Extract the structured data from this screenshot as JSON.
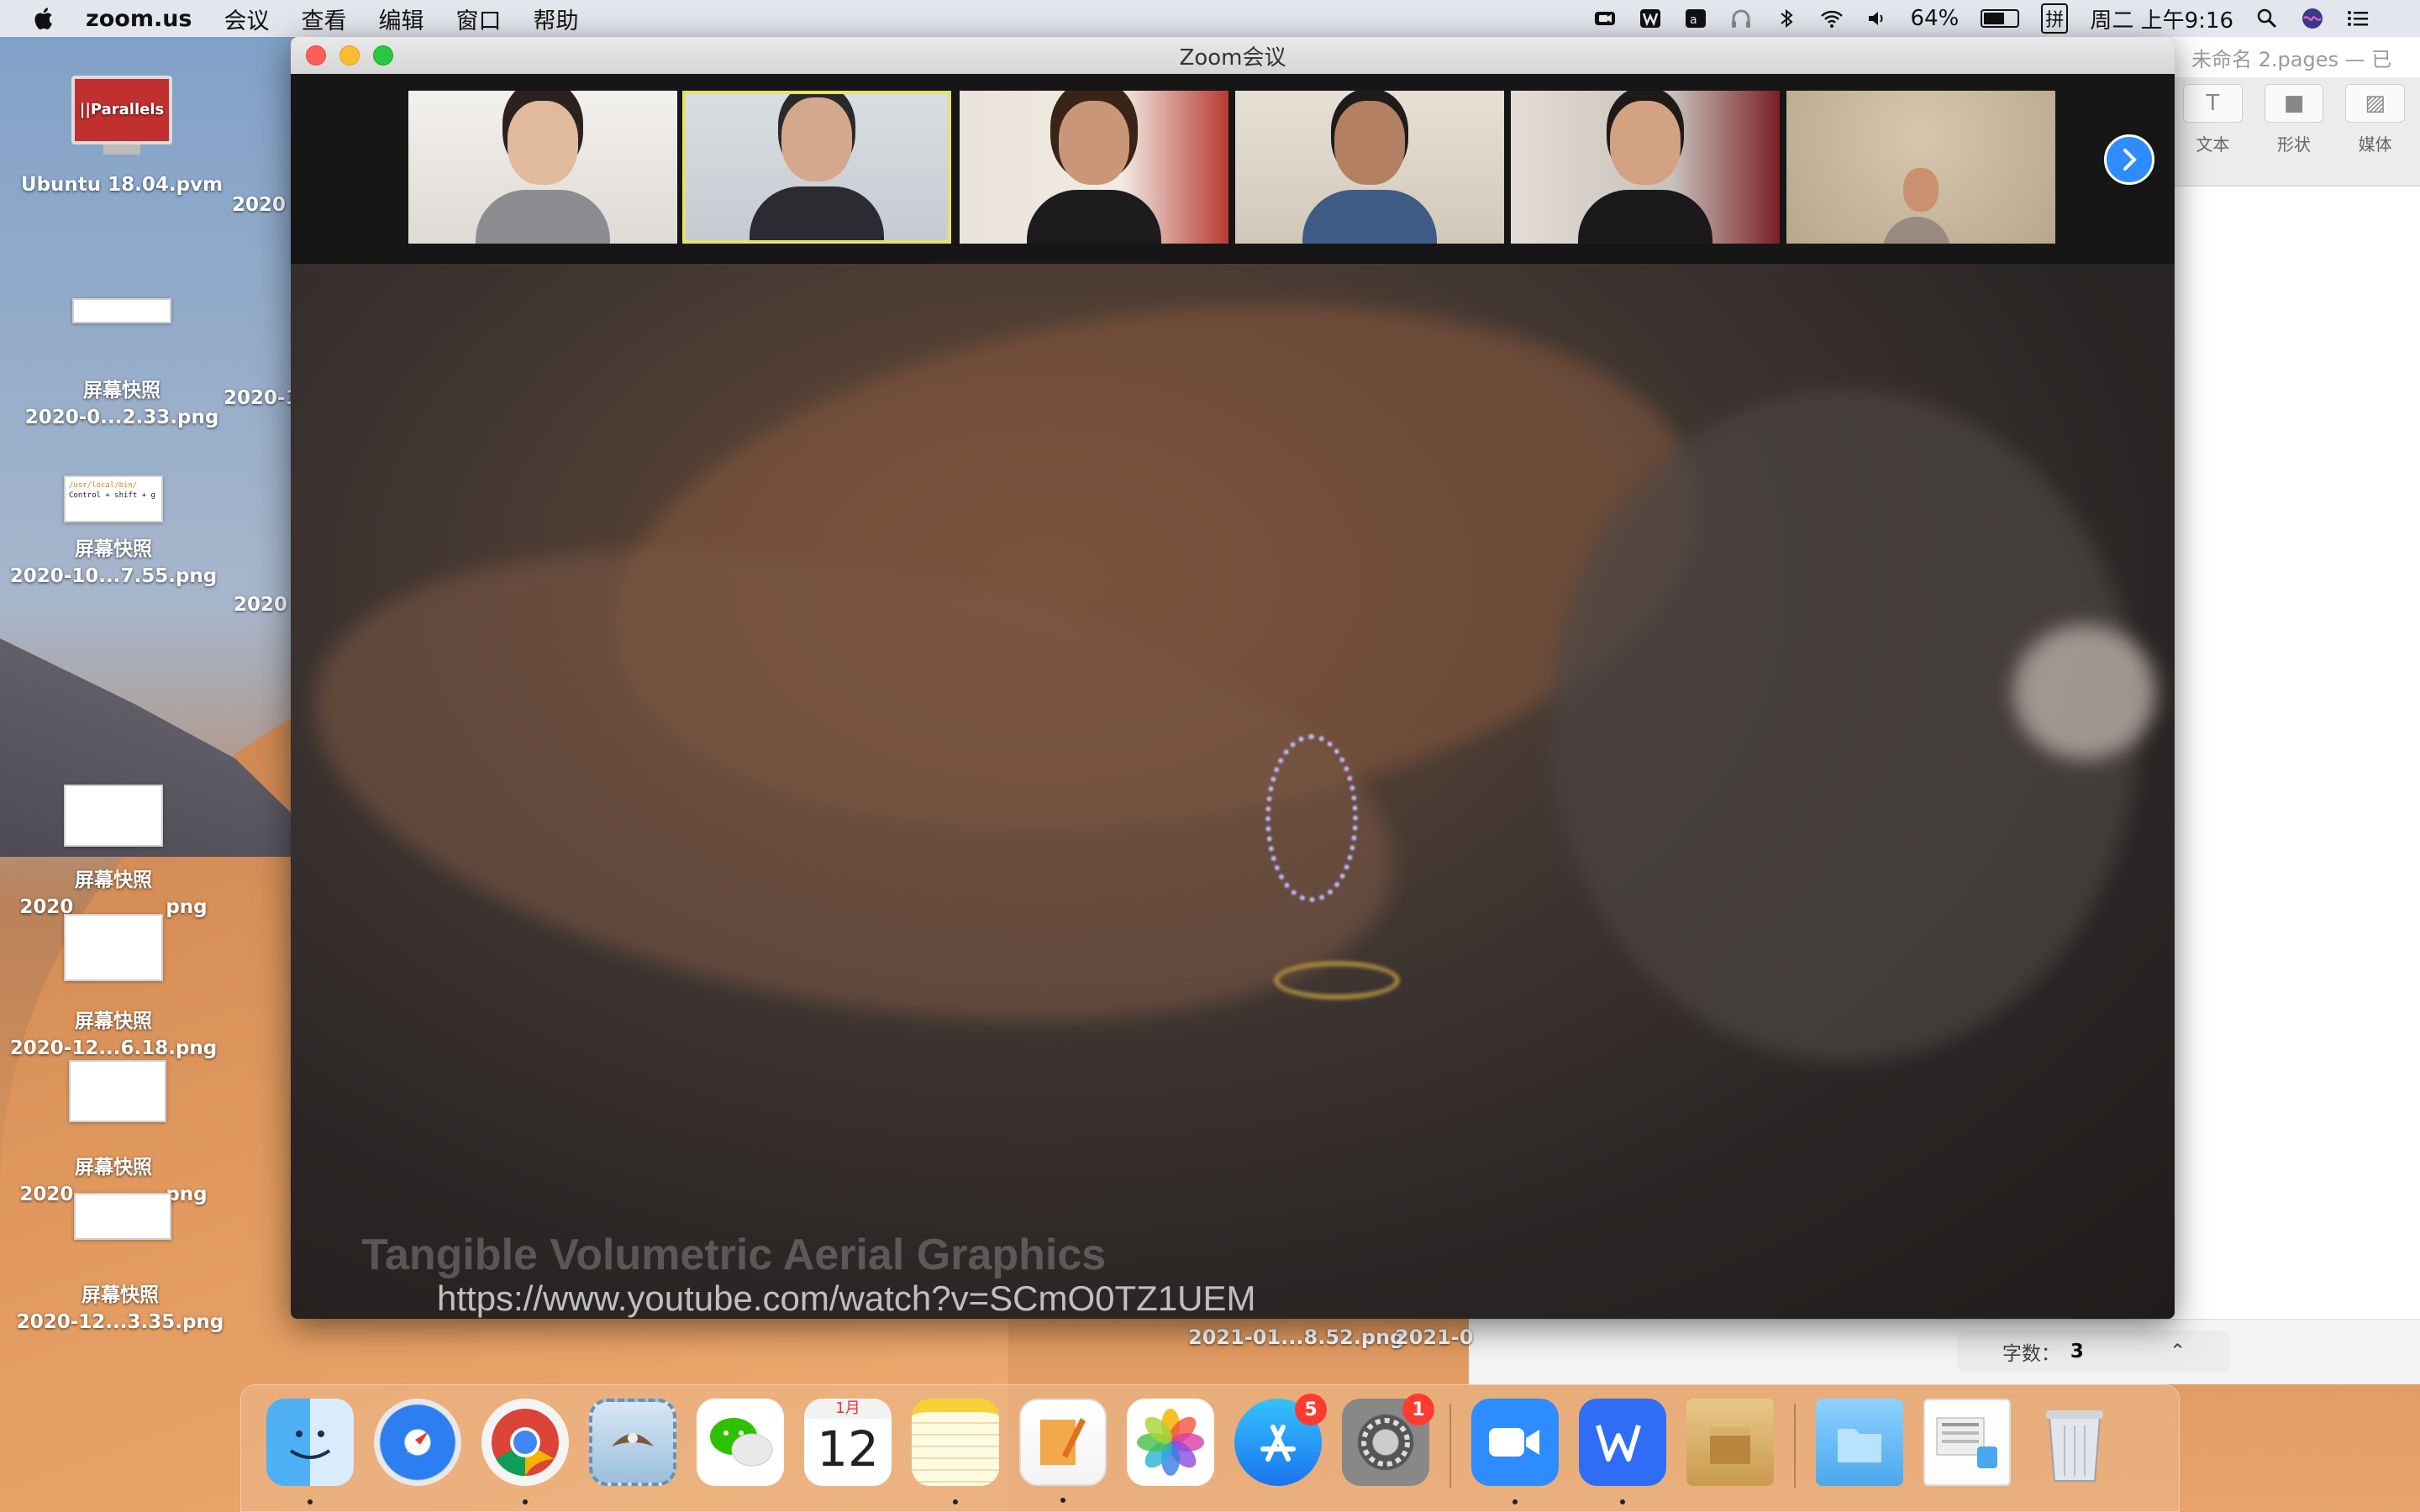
{
  "menubar": {
    "app_name": "zoom.us",
    "menus": [
      "会议",
      "查看",
      "编辑",
      "窗口",
      "帮助"
    ],
    "battery_percent": "64%",
    "battery_level": 0.64,
    "input_method": "拼",
    "clock": "周二 上午9:16"
  },
  "desktop_icons": [
    {
      "label": "Ubuntu 18.04.pvm",
      "badge": "||Parallels"
    },
    {
      "label1": "屏幕快照",
      "label2": "2020-0...2.33.png"
    },
    {
      "label1": "屏幕快照",
      "label2": "2020-10...7.55.png",
      "thumb_line1": "/usr/local/bin/",
      "thumb_line2": "Control + shift + g"
    },
    {
      "label1": "屏幕快照",
      "label2": "2020",
      "label2_end": "png"
    },
    {
      "label1": "屏幕快照",
      "label2": "2020-12...6.18.png"
    },
    {
      "label1": "屏幕快照",
      "label2": "2020",
      "label2_end": "png"
    },
    {
      "label1": "屏幕快照",
      "label2": "2020-12...3.35.png"
    }
  ],
  "second_column_labels": [
    "2020",
    "2020-1",
    "2020"
  ],
  "zoom": {
    "window_title": "Zoom会议",
    "participants": 6,
    "share_watermark": "Tangible Volumetric Aerial Graphics",
    "share_url": "https://www.youtube.com/watch?v=SCmO0TZ1UEM"
  },
  "under_window_labels": [
    "2021-01...8.52.png",
    "2021-0"
  ],
  "pages": {
    "title": "未命名 2.pages — 已",
    "toolbar": [
      "文本",
      "形状",
      "媒体"
    ],
    "word_count_label": "字数：",
    "word_count_value": "3"
  },
  "dock": {
    "calendar_month": "1月",
    "calendar_day": "12",
    "appstore_badge": "5",
    "prefs_badge": "1"
  }
}
